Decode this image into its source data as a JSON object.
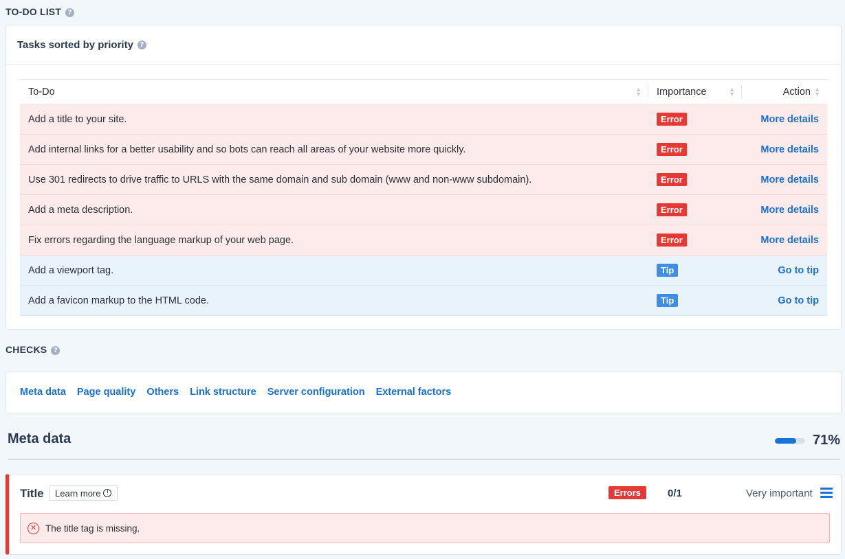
{
  "todo_section": {
    "title": "TO-DO LIST",
    "panel_title": "Tasks sorted by priority",
    "columns": {
      "todo": "To-Do",
      "importance": "Importance",
      "action": "Action"
    },
    "tasks": [
      {
        "text": "Add a title to your site.",
        "importance": "Error",
        "action": "More details"
      },
      {
        "text": "Add internal links for a better usability and so bots can reach all areas of your website more quickly.",
        "importance": "Error",
        "action": "More details"
      },
      {
        "text": "Use 301 redirects to drive traffic to URLS with the same domain and sub domain (www and non-www subdomain).",
        "importance": "Error",
        "action": "More details"
      },
      {
        "text": "Add a meta description.",
        "importance": "Error",
        "action": "More details"
      },
      {
        "text": "Fix errors regarding the language markup of your web page.",
        "importance": "Error",
        "action": "More details"
      },
      {
        "text": "Add a viewport tag.",
        "importance": "Tip",
        "action": "Go to tip"
      },
      {
        "text": "Add a favicon markup to the HTML code.",
        "importance": "Tip",
        "action": "Go to tip"
      }
    ]
  },
  "checks_section": {
    "title": "CHECKS",
    "nav": [
      "Meta data",
      "Page quality",
      "Others",
      "Link structure",
      "Server configuration",
      "External factors"
    ]
  },
  "meta_data": {
    "heading": "Meta data",
    "progress_percent": 71,
    "progress_label": "71%",
    "title_check": {
      "title": "Title",
      "learn_more": "Learn more",
      "status": "Errors",
      "score": "0/1",
      "importance": "Very important",
      "message": "The title tag is missing."
    }
  },
  "colors": {
    "error": "#e53935",
    "tip": "#3d8ee6",
    "link": "#1a6fd1",
    "error_row_bg": "#fdeaea",
    "tip_row_bg": "#e9f3fc",
    "page_bg": "#f2f7fc"
  },
  "icons": [
    "help-icon",
    "sort-icon",
    "info-icon",
    "hamburger-icon",
    "x-circle-icon"
  ]
}
